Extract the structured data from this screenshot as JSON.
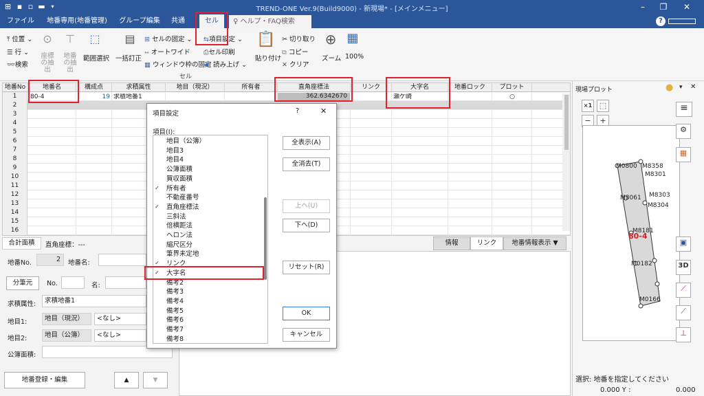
{
  "title": "TREND-ONE Ver.9(Build9000) - 新現場* - [メインメニュー]",
  "menu": {
    "tabs": [
      "ファイル",
      "地番専用(地番管理)",
      "グループ編集",
      "共通",
      "セル"
    ],
    "search": "ヘルプ・FAQ検索"
  },
  "ribbon": {
    "items": {
      "position": "位置",
      "row": "行",
      "search": "検索",
      "seat_extract": "座標の抽出",
      "lot_extract": "地番の抽出",
      "range_select": "範囲選択",
      "bulk_fix": "一括訂正",
      "cell_fix": "セルの固定",
      "auto_wide": "オートワイド",
      "window_fix": "ウィンドウ枠の固定",
      "item_settings": "項目設定",
      "cell_print": "セル印刷",
      "read_aloud": "読み上げ",
      "paste": "貼り付け",
      "cut": "切り取り",
      "copy": "コピー",
      "clear": "クリア",
      "zoom": "ズーム",
      "zoom100": "100%"
    },
    "group_label": "セル"
  },
  "grid": {
    "headers": [
      "地番No",
      "地番名",
      "構成点",
      "求積属性",
      "地目（現況）",
      "所有者",
      "直角座標法",
      "リンク",
      "大字名",
      "地番ロック",
      "プロット"
    ],
    "rows": [
      "1",
      "2",
      "3",
      "4",
      "5",
      "6",
      "7",
      "8",
      "9",
      "10",
      "11",
      "12",
      "13",
      "14",
      "15",
      "16"
    ],
    "row1": {
      "lot_name": "80-4",
      "points": "19",
      "attr": "求積地番1",
      "coord": "362.6342670",
      "oaza": "瀬ケ崎",
      "plot": "○"
    }
  },
  "bottom_left": {
    "tabs": [
      "合計面積"
    ],
    "coord_label": "直角座標：---",
    "lot_no_label": "地番No.",
    "lot_no_value": "2",
    "lot_name_label": "地番名:",
    "divide_button": "分筆元",
    "no_label": "No.",
    "name_label": "名:",
    "attr_label": "求積属性:",
    "attr_value": "求積地番1",
    "land1_label": "地目1:",
    "land1_type": "地目（現況）",
    "land1_value": "<なし>",
    "land2_label": "地目2:",
    "land2_type": "地目（公簿）",
    "land2_value": "<なし>",
    "public_area_label": "公簿面積:",
    "register_button": "地番登録・編集"
  },
  "bottom_right": {
    "tabs": [
      "情報",
      "リンク",
      "地番情報表示 ▼"
    ]
  },
  "plot": {
    "title": "現場プロット",
    "points": [
      "M0800",
      "M8358",
      "M8301",
      "M8303",
      "M8061",
      "M8304",
      "M8181",
      "80-4",
      "M0182",
      "M0166"
    ],
    "status": "選択: 地番を指定してください",
    "coord": "0.000 Y :",
    "coord_y": "0.000",
    "btn_3d": "3D"
  },
  "dialog": {
    "title": "項目設定",
    "help": "?",
    "list_label": "項目(I):",
    "items": [
      {
        "label": "地目（公簿）",
        "checked": false
      },
      {
        "label": "地目3",
        "checked": false
      },
      {
        "label": "地目4",
        "checked": false
      },
      {
        "label": "公簿面積",
        "checked": false
      },
      {
        "label": "買収面積",
        "checked": false
      },
      {
        "label": "所有者",
        "checked": true
      },
      {
        "label": "不動産番号",
        "checked": false
      },
      {
        "label": "直角座標法",
        "checked": true
      },
      {
        "label": "三斜法",
        "checked": false
      },
      {
        "label": "倍横距法",
        "checked": false
      },
      {
        "label": "ヘロン法",
        "checked": false
      },
      {
        "label": "縮尺区分",
        "checked": false
      },
      {
        "label": "筆界未定地",
        "checked": false
      },
      {
        "label": "リンク",
        "checked": true
      },
      {
        "label": "大字名",
        "checked": true
      },
      {
        "label": "備考2",
        "checked": false
      },
      {
        "label": "備考3",
        "checked": false
      },
      {
        "label": "備考4",
        "checked": false
      },
      {
        "label": "備考5",
        "checked": false
      },
      {
        "label": "備考6",
        "checked": false
      },
      {
        "label": "備考7",
        "checked": false
      },
      {
        "label": "備考8",
        "checked": false
      }
    ],
    "show_all": "全表示(A)",
    "clear_all": "全消去(T)",
    "up": "上へ(U)",
    "down": "下へ(D)",
    "reset": "リセット(R)",
    "ok": "OK",
    "cancel": "キャンセル"
  }
}
